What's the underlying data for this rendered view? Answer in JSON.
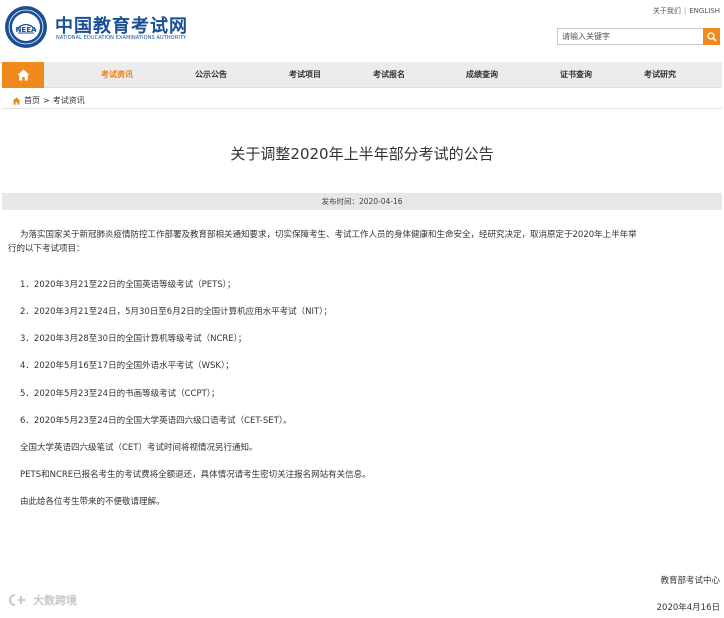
{
  "header": {
    "logo_text_cn": "中国教育考试网",
    "logo_text_en": "NATIONAL EDUCATION EXAMINATIONS AUTHORITY",
    "emblem_text": "NEEA",
    "top_links": [
      "关于我们",
      "ENGLISH"
    ],
    "search_placeholder": "请输入关键字"
  },
  "nav": {
    "home_icon": "home-icon",
    "items": [
      {
        "label": "考试资讯",
        "active": true
      },
      {
        "label": "公示公告",
        "active": false
      },
      {
        "label": "考试项目",
        "active": false
      },
      {
        "label": "考试报名",
        "active": false
      },
      {
        "label": "成绩查询",
        "active": false
      },
      {
        "label": "证书查询",
        "active": false
      },
      {
        "label": "考试研究",
        "active": false
      }
    ]
  },
  "breadcrumb": [
    "首页",
    "考试资讯"
  ],
  "article": {
    "title": "关于调整2020年上半年部分考试的公告",
    "publish_time": "发布时间：2020-04-16",
    "intro_line1": "为落实国家关于新冠肺炎疫情防控工作部署及教育部相关通知要求，切实保障考生、考试工作人员的身体健康和生命安全，经研究决定，取消原定于2020年上半年举",
    "intro_line2": "行的以下考试项目：",
    "items": [
      "1．2020年3月21至22日的全国英语等级考试（PETS）；",
      "2．2020年3月21至24日，5月30日至6月2日的全国计算机应用水平考试（NIT）；",
      "3．2020年3月28至30日的全国计算机等级考试（NCRE）；",
      "4．2020年5月16至17日的全国外语水平考试（WSK）；",
      "5．2020年5月23至24日的书画等级考试（CCPT）；",
      "6．2020年5月23至24日的全国大学英语四六级口语考试（CET-SET）。"
    ],
    "note_cet": "全国大学英语四六级笔试（CET）考试时间将视情况另行通知。",
    "note_refund": "PETS和NCRE已报名考生的考试费将全额退还，具体情况请考生密切关注报名网站有关信息。",
    "closing": "由此给各位考生带来的不便敬请理解。",
    "signature_org": "教育部考试中心",
    "signature_date": "2020年4月16日"
  },
  "watermark": "大数跨境",
  "colors": {
    "brand_blue": "#1b4f95",
    "accent_orange": "#f08a1c",
    "nav_bg": "#ececec"
  }
}
